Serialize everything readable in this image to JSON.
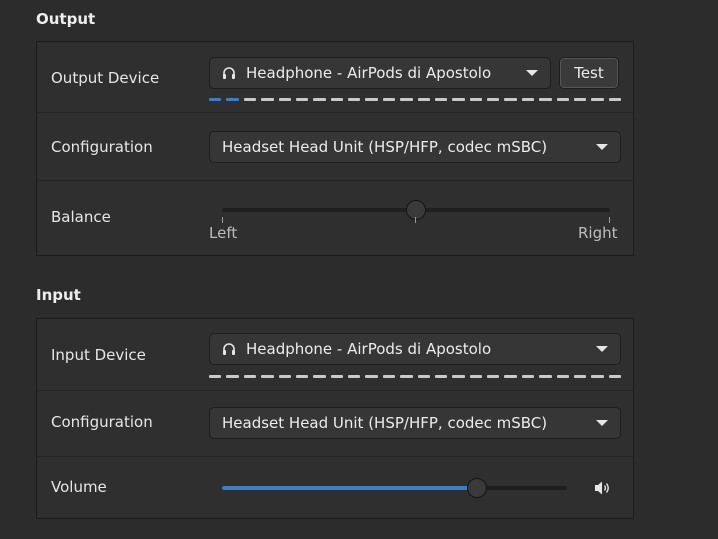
{
  "output": {
    "section_title": "Output",
    "device": {
      "label": "Output Device",
      "value": "Headphone - AirPods di Apostolo",
      "icon": "headphones-icon",
      "test_label": "Test",
      "level_segments": 24,
      "level_active": 2
    },
    "configuration": {
      "label": "Configuration",
      "value": "Headset Head Unit (HSP/HFP, codec mSBC)"
    },
    "balance": {
      "label": "Balance",
      "left_label": "Left",
      "right_label": "Right",
      "value": 0.5
    }
  },
  "input": {
    "section_title": "Input",
    "device": {
      "label": "Input Device",
      "value": "Headphone - AirPods di Apostolo",
      "icon": "headphones-icon",
      "level_segments": 24,
      "level_active": 0
    },
    "configuration": {
      "label": "Configuration",
      "value": "Headset Head Unit (HSP/HFP, codec mSBC)"
    },
    "volume": {
      "label": "Volume",
      "value": 0.74,
      "icon": "speaker-volume-icon"
    }
  },
  "colors": {
    "accent": "#3f7dc4",
    "background": "#2c2c2c",
    "group_background": "#2f2f2f"
  }
}
